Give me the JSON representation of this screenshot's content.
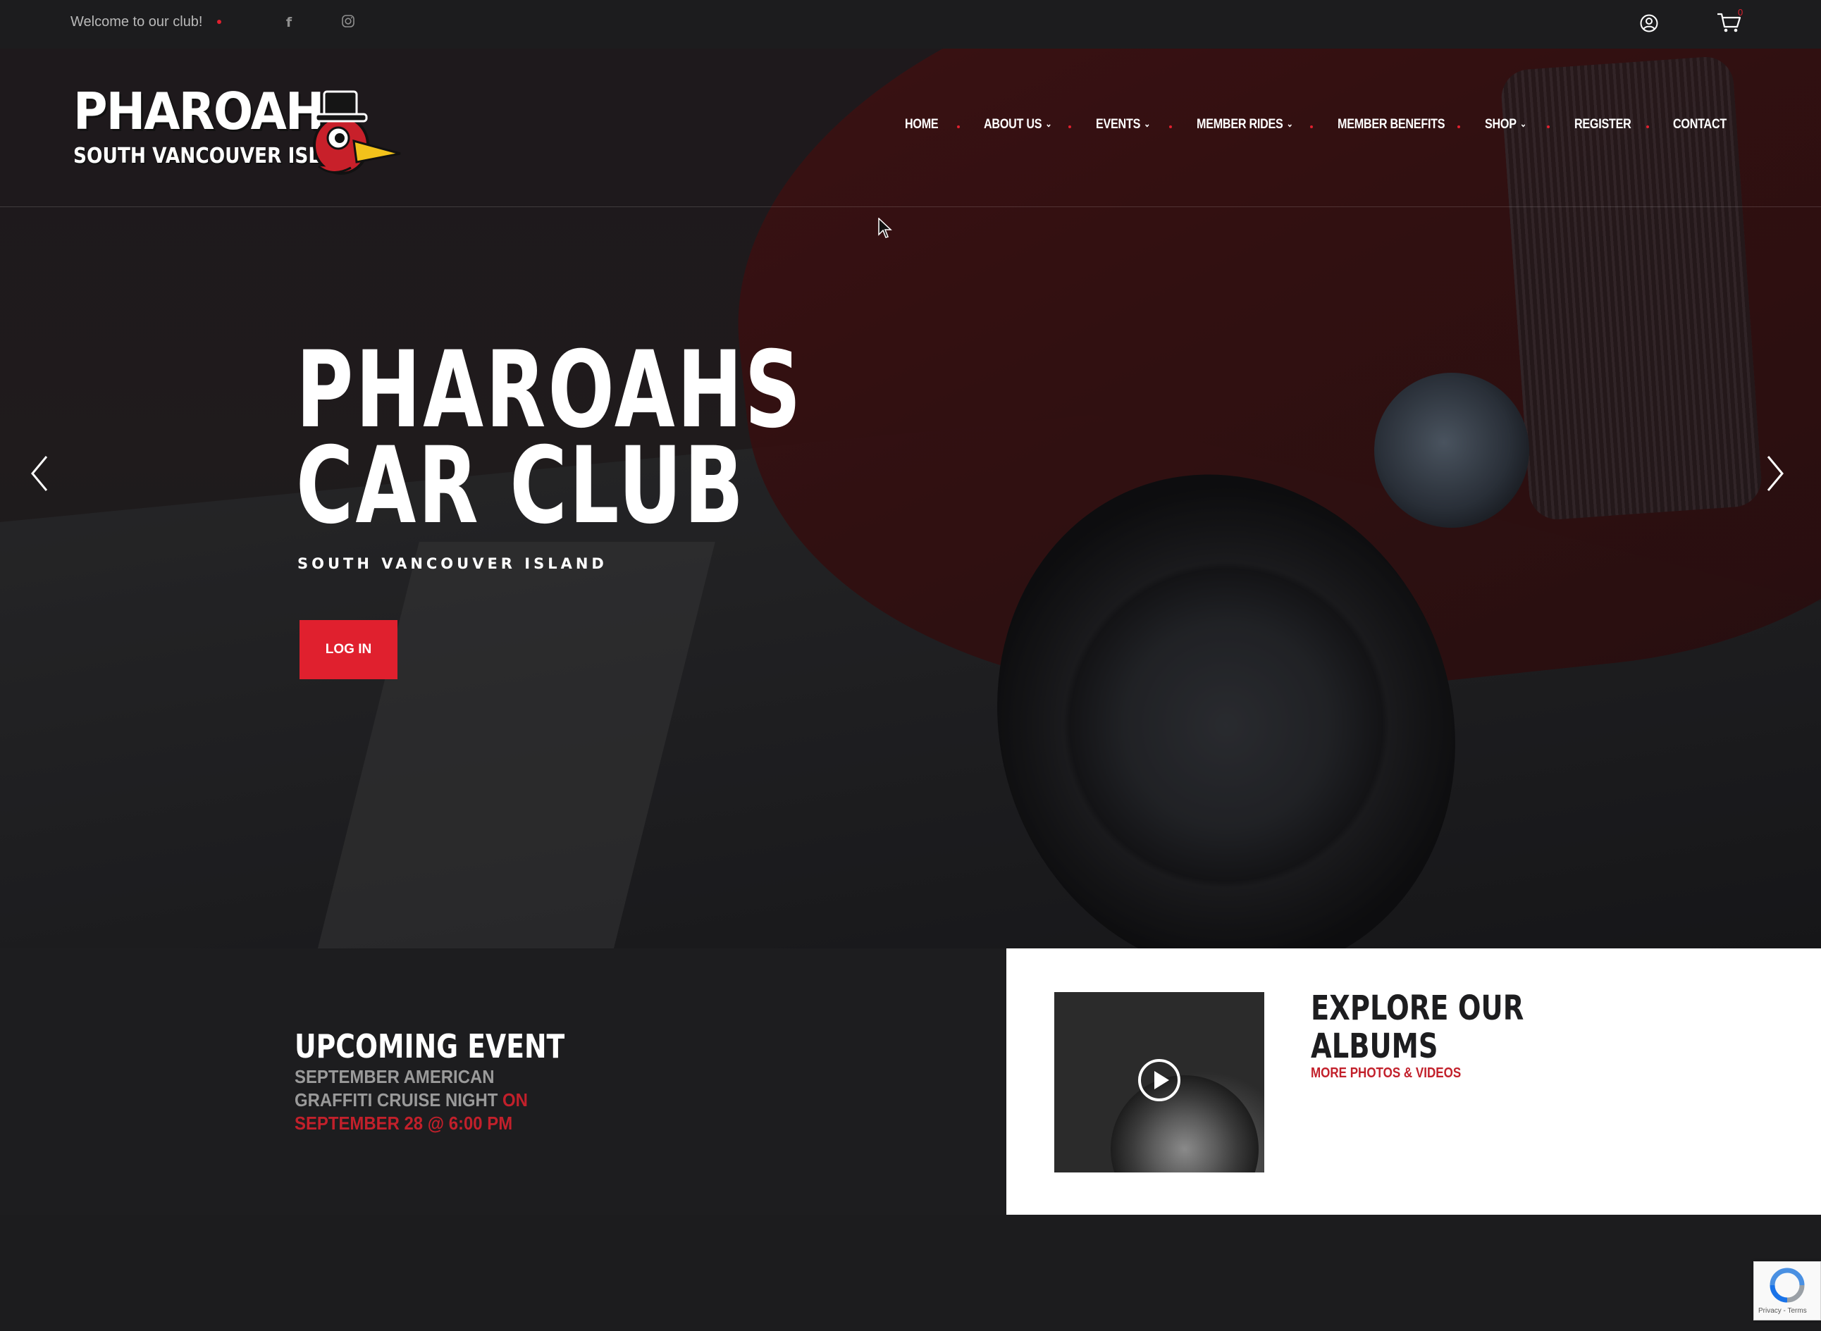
{
  "topbar": {
    "welcome": "Welcome to our club!",
    "social": [
      "facebook-icon",
      "instagram-icon"
    ],
    "cart_count": "0"
  },
  "brand": {
    "logo_line1": "PHAROAHS",
    "logo_line2": "SOUTH VANCOUVER ISLAND"
  },
  "nav": {
    "items": [
      {
        "label": "HOME",
        "dropdown": false
      },
      {
        "label": "ABOUT US",
        "dropdown": true
      },
      {
        "label": "EVENTS",
        "dropdown": true
      },
      {
        "label": "MEMBER RIDES",
        "dropdown": true
      },
      {
        "label": "MEMBER BENEFITS",
        "dropdown": false
      },
      {
        "label": "SHOP",
        "dropdown": true
      },
      {
        "label": "REGISTER",
        "dropdown": false
      },
      {
        "label": "CONTACT",
        "dropdown": false
      }
    ]
  },
  "hero": {
    "title_line1": "PHAROAHS",
    "title_line2": "CAR CLUB",
    "subtitle": "SOUTH VANCOUVER ISLAND",
    "button": "LOG IN"
  },
  "event": {
    "heading": "UPCOMING EVENT",
    "name": "SEPTEMBER AMERICAN GRAFFITI CRUISE NIGHT",
    "when": "ON SEPTEMBER 28 @ 6:00 PM"
  },
  "albums": {
    "title_line1": "EXPLORE OUR",
    "title_line2": "ALBUMS",
    "link": "MORE PHOTOS & VIDEOS"
  },
  "recaptcha": {
    "text": "Privacy - Terms"
  },
  "colors": {
    "accent": "#e0202e",
    "dark": "#1d1d1f",
    "link_red": "#c2202b"
  }
}
